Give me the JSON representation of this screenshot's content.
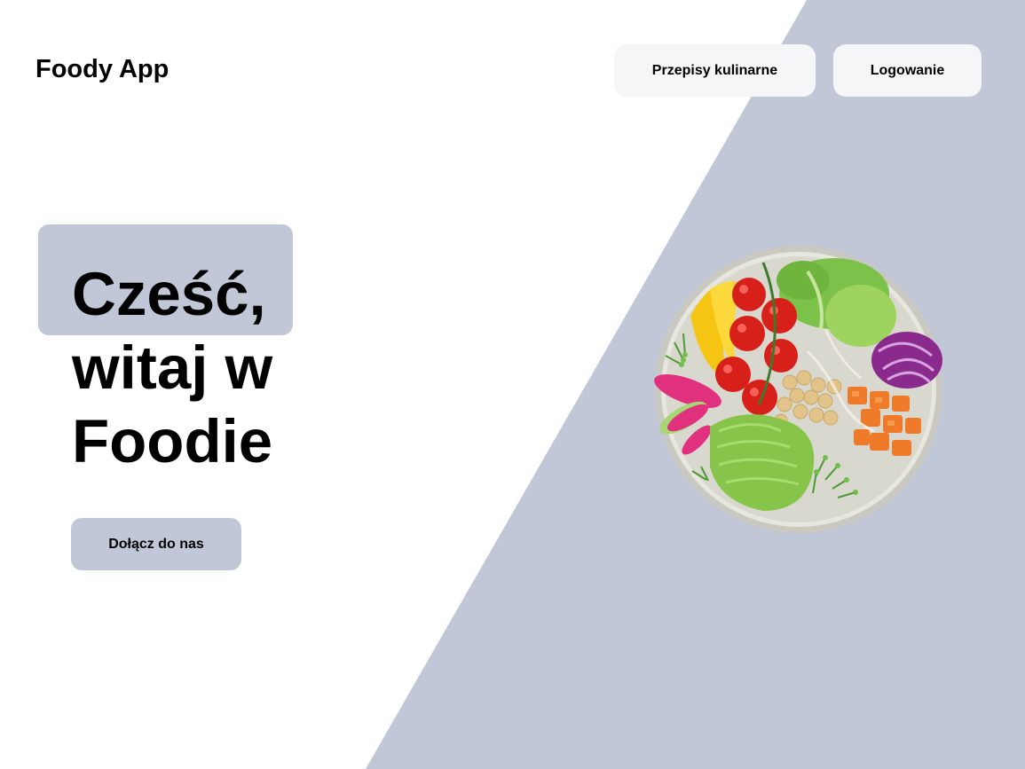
{
  "header": {
    "logo": "Foody App",
    "nav": [
      {
        "label": "Przepisy kulinarne"
      },
      {
        "label": "Logowanie"
      }
    ]
  },
  "hero": {
    "title_lines": [
      "Cześć,",
      "witaj w",
      "Foodie"
    ],
    "cta_label": "Dołącz do nas",
    "image": "salad-bowl-photo"
  },
  "colors": {
    "accent": "#c1c7d6",
    "nav_button_bg": "#f5f6f8",
    "background": "#ffffff",
    "text": "#000000"
  }
}
